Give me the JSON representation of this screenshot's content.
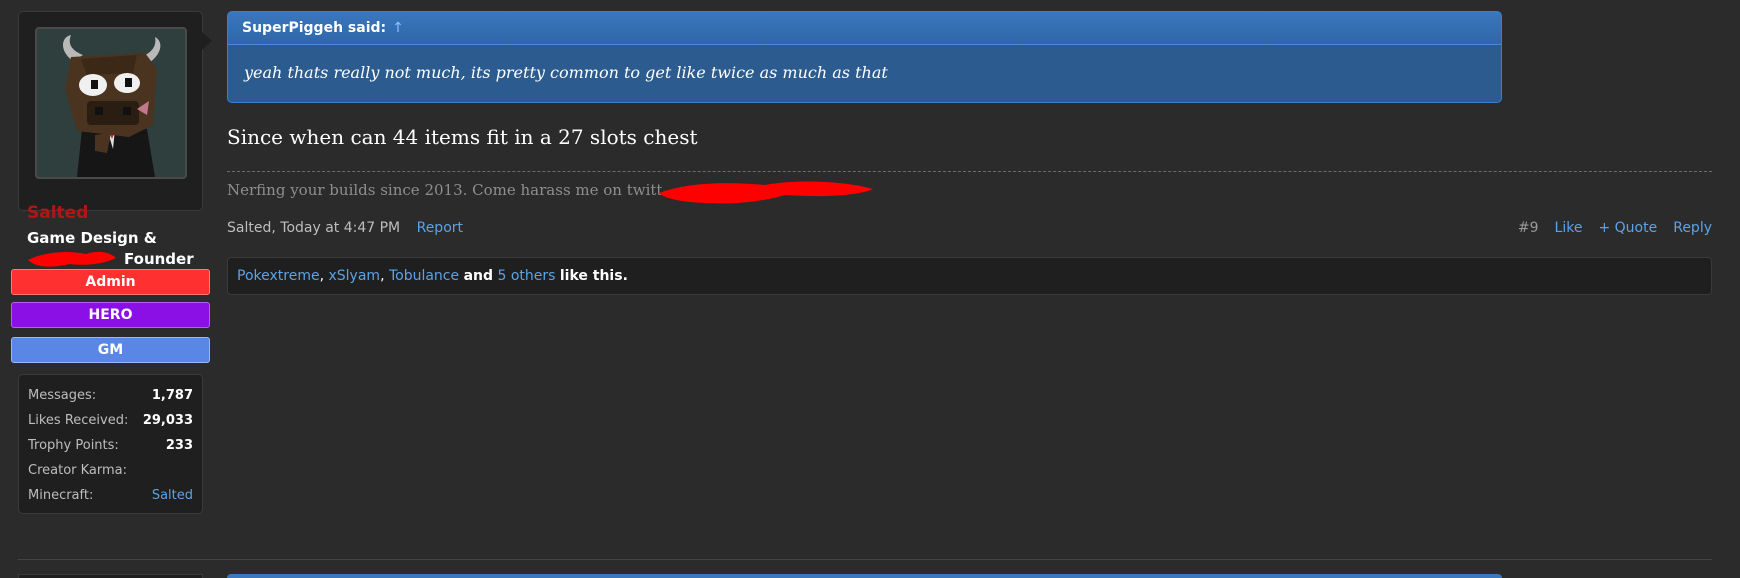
{
  "user": {
    "name": "Salted",
    "title_line1": "Game Design &",
    "title_line2": "Founder",
    "badges": [
      "Admin",
      "HERO",
      "GM"
    ],
    "stats": [
      {
        "label": "Messages:",
        "value": "1,787"
      },
      {
        "label": "Likes Received:",
        "value": "29,033"
      },
      {
        "label": "Trophy Points:",
        "value": "233"
      },
      {
        "label": "Creator Karma:",
        "value": ""
      },
      {
        "label": "Minecraft:",
        "value": "Salted"
      }
    ]
  },
  "quote": {
    "author": "SuperPiggeh said:",
    "arrow": "↑",
    "text": "yeah thats really not much, its pretty common to get like twice as much as that"
  },
  "message": {
    "text": "Since when can 44 items fit in a 27 slots chest",
    "signature": "Nerfing your builds since 2013. Come harass me on twitt"
  },
  "meta": {
    "author": "Salted",
    "time": "Today at 4:47 PM",
    "report": "Report",
    "post_number": "#9",
    "like": "Like",
    "quote": "+ Quote",
    "reply": "Reply"
  },
  "likes": {
    "user1": "Pokextreme",
    "user2": "xSlyam",
    "user3": "Tobulance",
    "and": "and",
    "others": "5 others",
    "suffix": "like this."
  },
  "colors": {
    "background": "#2b2b2b",
    "link": "#5aa3e6",
    "username": "#b01616",
    "admin_badge": "#ff3030",
    "hero_badge": "#8a10e6",
    "gm_badge": "#5a86e6",
    "quote_bg": "#2c5c8f",
    "redaction": "#ff0000"
  }
}
